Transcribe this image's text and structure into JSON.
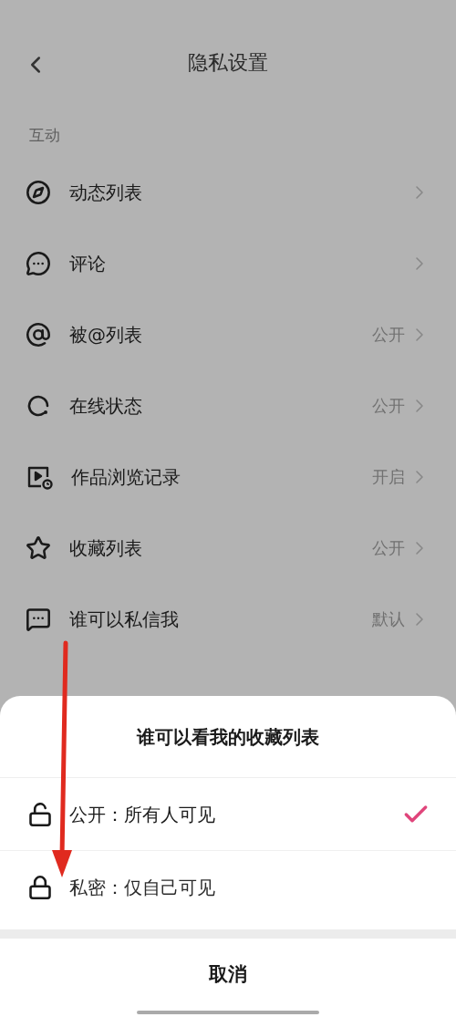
{
  "header": {
    "title": "隐私设置"
  },
  "section": {
    "title": "互动"
  },
  "items": [
    {
      "label": "动态列表"
    },
    {
      "label": "评论"
    },
    {
      "label": "被@列表",
      "value": "公开"
    },
    {
      "label": "在线状态",
      "value": "公开"
    },
    {
      "label": "作品浏览记录",
      "value": "开启"
    },
    {
      "label": "收藏列表",
      "value": "公开"
    },
    {
      "label": "谁可以私信我",
      "value": "默认"
    }
  ],
  "sheet": {
    "title": "谁可以看我的收藏列表",
    "options": [
      {
        "label": "公开：所有人可见",
        "selected": true
      },
      {
        "label": "私密：仅自己可见",
        "selected": false
      }
    ],
    "cancel": "取消"
  }
}
